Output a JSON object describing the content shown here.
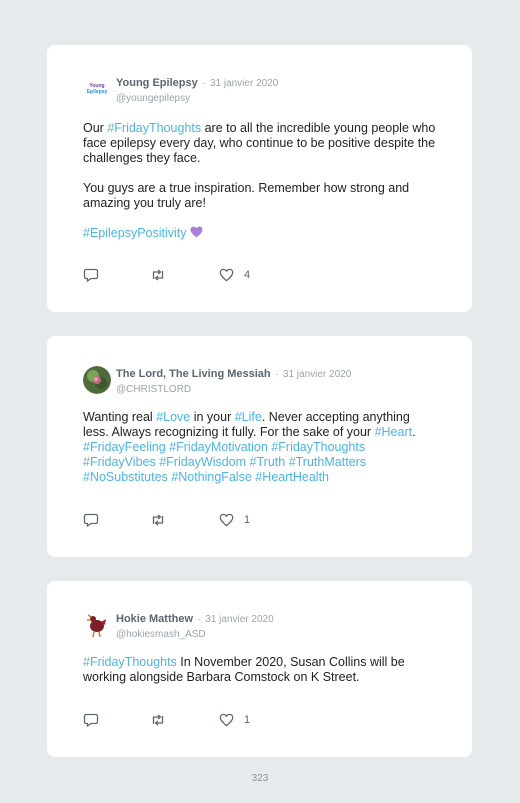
{
  "tweets": [
    {
      "name": "Young Epilepsy",
      "sep": "·",
      "date": "31 janvier 2020",
      "handle": "@youngepilepsy",
      "avatar_text": "Young Epilepsy",
      "p1": [
        {
          "t": "Our ",
          "tag": false
        },
        {
          "t": "#FridayThoughts",
          "tag": true
        },
        {
          "t": " are to all the incredible young people who face epilepsy every day, who continue to be positive despite the challenges they face.",
          "tag": false
        }
      ],
      "p2": "You guys are a true inspiration. Remember how strong and amazing you truly are!",
      "p3_tag": "#EpilepsyPositivity",
      "emoji": "purple-heart",
      "likes": "4"
    },
    {
      "name": "The Lord, The Living Messiah",
      "sep": "·",
      "date": "31 janvier 2020",
      "handle": "@CHRISTLORD",
      "p1": [
        {
          "t": "Wanting real ",
          "tag": false
        },
        {
          "t": "#Love",
          "tag": true
        },
        {
          "t": " in your ",
          "tag": false
        },
        {
          "t": "#Life",
          "tag": true
        },
        {
          "t": ". Never accepting anything less. Always recognizing it fully. For the sake of your ",
          "tag": false
        },
        {
          "t": "#Heart",
          "tag": true
        },
        {
          "t": ". ",
          "tag": false
        },
        {
          "t": "#FridayFeeling",
          "tag": true
        },
        {
          "t": " ",
          "tag": false
        },
        {
          "t": "#FridayMotivation",
          "tag": true
        },
        {
          "t": " ",
          "tag": false
        },
        {
          "t": "#FridayThoughts",
          "tag": true
        },
        {
          "t": " ",
          "tag": false
        },
        {
          "t": "#FridayVibes",
          "tag": true
        },
        {
          "t": " ",
          "tag": false
        },
        {
          "t": "#FridayWisdom",
          "tag": true
        },
        {
          "t": " ",
          "tag": false
        },
        {
          "t": "#Truth",
          "tag": true
        },
        {
          "t": " ",
          "tag": false
        },
        {
          "t": "#TruthMatters",
          "tag": true
        },
        {
          "t": " ",
          "tag": false
        },
        {
          "t": "#NoSubstitutes",
          "tag": true
        },
        {
          "t": " ",
          "tag": false
        },
        {
          "t": "#NothingFalse",
          "tag": true
        },
        {
          "t": " ",
          "tag": false
        },
        {
          "t": "#HeartHealth",
          "tag": true
        }
      ],
      "likes": "1"
    },
    {
      "name": "Hokie Matthew",
      "sep": "·",
      "date": "31 janvier 2020",
      "handle": "@hokiesmash_ASD",
      "p1": [
        {
          "t": "#FridayThoughts",
          "tag": true
        },
        {
          "t": " In November 2020, Susan Collins will be working alongside Barbara Comstock on K Street.",
          "tag": false
        }
      ],
      "likes": "1"
    }
  ],
  "page_number": "323",
  "colors": {
    "hashtag": "#4db4e2",
    "icon": "#5b6670",
    "background": "#e6eaed"
  }
}
